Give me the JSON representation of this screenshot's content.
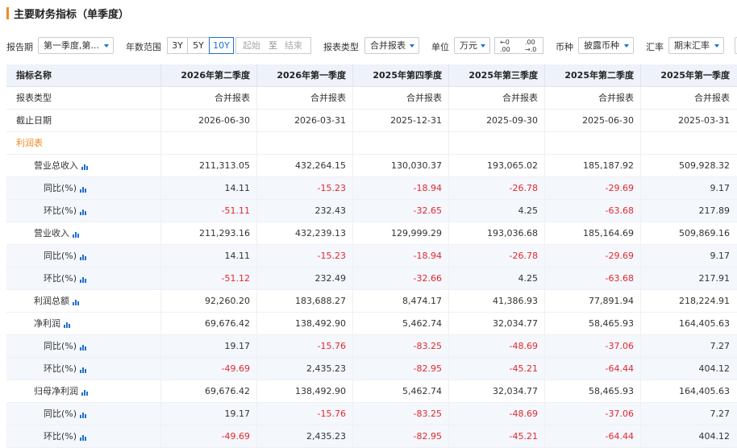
{
  "title": "主要财务指标（单季度）",
  "toolbar": {
    "report_period_label": "报告期",
    "report_period_value": "第一季度,第...",
    "year_range_label": "年数范围",
    "year_options": [
      "3Y",
      "5Y",
      "10Y"
    ],
    "year_active": "10Y",
    "range_start": "起始",
    "range_to": "至",
    "range_end": "结束",
    "report_type_label": "报表类型",
    "report_type_value": "合并报表",
    "unit_label": "单位",
    "unit_value": "万元",
    "decimal_decrease": "←0 .00",
    "decimal_increase": ".00 →.0",
    "currency_label": "币种",
    "currency_value": "披露币种",
    "rate_label": "汇率",
    "rate_value": "期末汇率"
  },
  "table": {
    "header_name": "指标名称",
    "columns": [
      "2026年第二季度",
      "2026年第一季度",
      "2025年第四季度",
      "2025年第三季度",
      "2025年第二季度",
      "2025年第一季度"
    ],
    "rows": [
      {
        "name": "报表类型",
        "level": 0,
        "chart": false,
        "values": [
          "合并报表",
          "合并报表",
          "合并报表",
          "合并报表",
          "合并报表",
          "合并报表"
        ]
      },
      {
        "name": "截止日期",
        "level": 0,
        "chart": false,
        "values": [
          "2026-06-30",
          "2026-03-31",
          "2025-12-31",
          "2025-09-30",
          "2025-06-30",
          "2025-03-31"
        ]
      },
      {
        "name": "利润表",
        "level": 0,
        "section": true,
        "chart": false,
        "values": [
          "",
          "",
          "",
          "",
          "",
          ""
        ]
      },
      {
        "name": "营业总收入",
        "level": 1,
        "chart": true,
        "values": [
          "211,313.05",
          "432,264.15",
          "130,030.37",
          "193,065.02",
          "185,187.92",
          "509,928.32"
        ]
      },
      {
        "name": "同比(%)",
        "level": 2,
        "chart": true,
        "shaded": true,
        "values": [
          "14.11",
          "-15.23",
          "-18.94",
          "-26.78",
          "-29.69",
          "9.17"
        ]
      },
      {
        "name": "环比(%)",
        "level": 2,
        "chart": true,
        "shaded": true,
        "values": [
          "-51.11",
          "232.43",
          "-32.65",
          "4.25",
          "-63.68",
          "217.89"
        ]
      },
      {
        "name": "营业收入",
        "level": 1,
        "chart": true,
        "values": [
          "211,293.16",
          "432,239.13",
          "129,999.29",
          "193,036.68",
          "185,164.69",
          "509,869.16"
        ]
      },
      {
        "name": "同比(%)",
        "level": 2,
        "chart": true,
        "shaded": true,
        "values": [
          "14.11",
          "-15.23",
          "-18.94",
          "-26.78",
          "-29.69",
          "9.17"
        ]
      },
      {
        "name": "环比(%)",
        "level": 2,
        "chart": true,
        "shaded": true,
        "values": [
          "-51.12",
          "232.49",
          "-32.66",
          "4.25",
          "-63.68",
          "217.91"
        ]
      },
      {
        "name": "利润总额",
        "level": 1,
        "chart": true,
        "values": [
          "92,260.20",
          "183,688.27",
          "8,474.17",
          "41,386.93",
          "77,891.94",
          "218,224.91"
        ]
      },
      {
        "name": "净利润",
        "level": 1,
        "chart": true,
        "values": [
          "69,676.42",
          "138,492.90",
          "5,462.74",
          "32,034.77",
          "58,465.93",
          "164,405.63"
        ]
      },
      {
        "name": "同比(%)",
        "level": 2,
        "chart": true,
        "shaded": true,
        "values": [
          "19.17",
          "-15.76",
          "-83.25",
          "-48.69",
          "-37.06",
          "7.27"
        ]
      },
      {
        "name": "环比(%)",
        "level": 2,
        "chart": true,
        "shaded": true,
        "values": [
          "-49.69",
          "2,435.23",
          "-82.95",
          "-45.21",
          "-64.44",
          "404.12"
        ]
      },
      {
        "name": "归母净利润",
        "level": 1,
        "chart": true,
        "values": [
          "69,676.42",
          "138,492.90",
          "5,462.74",
          "32,034.77",
          "58,465.93",
          "164,405.63"
        ]
      },
      {
        "name": "同比(%)",
        "level": 2,
        "chart": true,
        "shaded": true,
        "values": [
          "19.17",
          "-15.76",
          "-83.25",
          "-48.69",
          "-37.06",
          "7.27"
        ]
      },
      {
        "name": "环比(%)",
        "level": 2,
        "chart": true,
        "shaded": true,
        "values": [
          "-49.69",
          "2,435.23",
          "-82.95",
          "-45.21",
          "-64.44",
          "404.12"
        ]
      }
    ]
  },
  "colors": {
    "accent": "#f08a24",
    "negative": "#e2282e",
    "link": "#1f6fd1"
  },
  "icons": {
    "row_chart": "bar-chart-icon",
    "dropdown": "chevron-down-icon"
  }
}
